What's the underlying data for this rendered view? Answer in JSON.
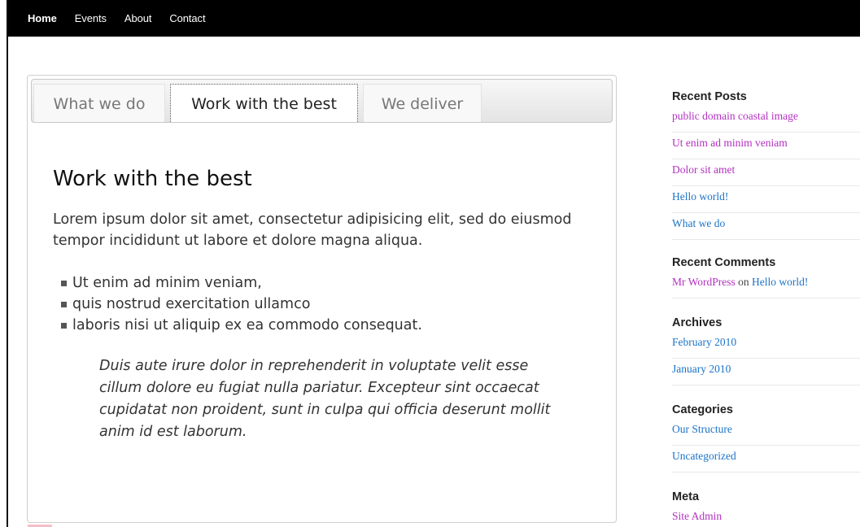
{
  "nav": {
    "items": [
      {
        "label": "Home",
        "active": true
      },
      {
        "label": "Events",
        "active": false
      },
      {
        "label": "About",
        "active": false
      },
      {
        "label": "Contact",
        "active": false
      }
    ]
  },
  "tabs": [
    {
      "label": "What we do"
    },
    {
      "label": "Work with the best"
    },
    {
      "label": "We deliver"
    }
  ],
  "content": {
    "heading": "Work with the best",
    "lead": "Lorem ipsum dolor sit amet, consectetur adipisicing elit, sed do eiusmod tempor incididunt ut labore et dolore magna aliqua.",
    "bullets": [
      "Ut enim ad minim veniam,",
      "quis nostrud exercitation ullamco",
      "laboris nisi ut aliquip ex ea commodo consequat."
    ],
    "quote": "Duis aute irure dolor in reprehenderit in voluptate velit esse cillum dolore eu fugiat nulla pariatur. Excepteur sint occaecat cupidatat non proident, sunt in culpa qui officia deserunt mollit anim id est laborum."
  },
  "sidebar": {
    "recent_posts": {
      "title": "Recent Posts",
      "items": [
        "public domain coastal image",
        "Ut enim ad minim veniam",
        "Dolor sit amet",
        "Hello world!",
        "What we do"
      ]
    },
    "recent_comments": {
      "title": "Recent Comments",
      "author": "Mr WordPress",
      "on": "on",
      "post": "Hello world!"
    },
    "archives": {
      "title": "Archives",
      "items": [
        "February 2010",
        "January 2010"
      ]
    },
    "categories": {
      "title": "Categories",
      "items": [
        "Our Structure",
        "Uncategorized"
      ]
    },
    "meta": {
      "title": "Meta",
      "items": [
        "Site Admin"
      ]
    }
  },
  "colors": {
    "visited_link": "#b330c1",
    "link": "#1a73c8",
    "topbar": "#000000"
  }
}
